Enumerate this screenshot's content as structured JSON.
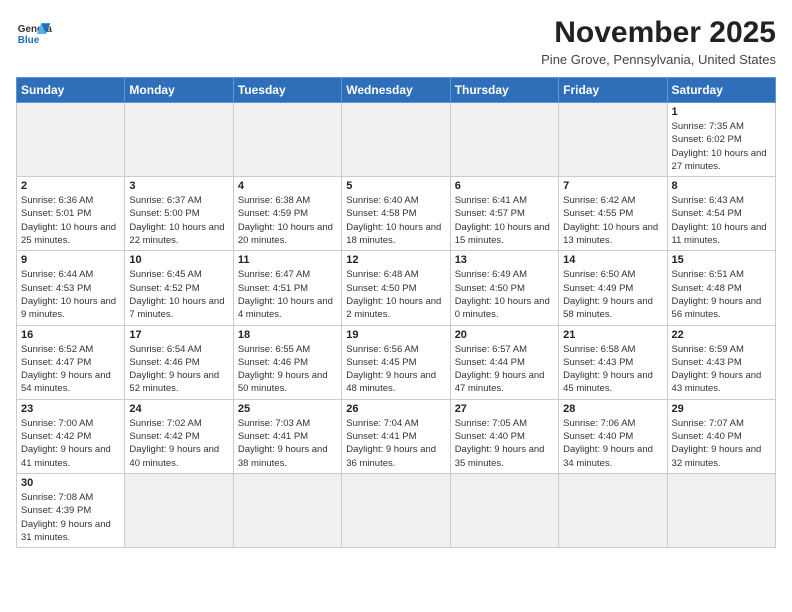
{
  "header": {
    "logo_general": "General",
    "logo_blue": "Blue",
    "title": "November 2025",
    "subtitle": "Pine Grove, Pennsylvania, United States"
  },
  "days_of_week": [
    "Sunday",
    "Monday",
    "Tuesday",
    "Wednesday",
    "Thursday",
    "Friday",
    "Saturday"
  ],
  "weeks": [
    [
      {
        "day": "",
        "empty": true
      },
      {
        "day": "",
        "empty": true
      },
      {
        "day": "",
        "empty": true
      },
      {
        "day": "",
        "empty": true
      },
      {
        "day": "",
        "empty": true
      },
      {
        "day": "",
        "empty": true
      },
      {
        "day": "1",
        "info": "Sunrise: 7:35 AM\nSunset: 6:02 PM\nDaylight: 10 hours and 27 minutes."
      }
    ],
    [
      {
        "day": "2",
        "info": "Sunrise: 6:36 AM\nSunset: 5:01 PM\nDaylight: 10 hours and 25 minutes."
      },
      {
        "day": "3",
        "info": "Sunrise: 6:37 AM\nSunset: 5:00 PM\nDaylight: 10 hours and 22 minutes."
      },
      {
        "day": "4",
        "info": "Sunrise: 6:38 AM\nSunset: 4:59 PM\nDaylight: 10 hours and 20 minutes."
      },
      {
        "day": "5",
        "info": "Sunrise: 6:40 AM\nSunset: 4:58 PM\nDaylight: 10 hours and 18 minutes."
      },
      {
        "day": "6",
        "info": "Sunrise: 6:41 AM\nSunset: 4:57 PM\nDaylight: 10 hours and 15 minutes."
      },
      {
        "day": "7",
        "info": "Sunrise: 6:42 AM\nSunset: 4:55 PM\nDaylight: 10 hours and 13 minutes."
      },
      {
        "day": "8",
        "info": "Sunrise: 6:43 AM\nSunset: 4:54 PM\nDaylight: 10 hours and 11 minutes."
      }
    ],
    [
      {
        "day": "9",
        "info": "Sunrise: 6:44 AM\nSunset: 4:53 PM\nDaylight: 10 hours and 9 minutes."
      },
      {
        "day": "10",
        "info": "Sunrise: 6:45 AM\nSunset: 4:52 PM\nDaylight: 10 hours and 7 minutes."
      },
      {
        "day": "11",
        "info": "Sunrise: 6:47 AM\nSunset: 4:51 PM\nDaylight: 10 hours and 4 minutes."
      },
      {
        "day": "12",
        "info": "Sunrise: 6:48 AM\nSunset: 4:50 PM\nDaylight: 10 hours and 2 minutes."
      },
      {
        "day": "13",
        "info": "Sunrise: 6:49 AM\nSunset: 4:50 PM\nDaylight: 10 hours and 0 minutes."
      },
      {
        "day": "14",
        "info": "Sunrise: 6:50 AM\nSunset: 4:49 PM\nDaylight: 9 hours and 58 minutes."
      },
      {
        "day": "15",
        "info": "Sunrise: 6:51 AM\nSunset: 4:48 PM\nDaylight: 9 hours and 56 minutes."
      }
    ],
    [
      {
        "day": "16",
        "info": "Sunrise: 6:52 AM\nSunset: 4:47 PM\nDaylight: 9 hours and 54 minutes."
      },
      {
        "day": "17",
        "info": "Sunrise: 6:54 AM\nSunset: 4:46 PM\nDaylight: 9 hours and 52 minutes."
      },
      {
        "day": "18",
        "info": "Sunrise: 6:55 AM\nSunset: 4:46 PM\nDaylight: 9 hours and 50 minutes."
      },
      {
        "day": "19",
        "info": "Sunrise: 6:56 AM\nSunset: 4:45 PM\nDaylight: 9 hours and 48 minutes."
      },
      {
        "day": "20",
        "info": "Sunrise: 6:57 AM\nSunset: 4:44 PM\nDaylight: 9 hours and 47 minutes."
      },
      {
        "day": "21",
        "info": "Sunrise: 6:58 AM\nSunset: 4:43 PM\nDaylight: 9 hours and 45 minutes."
      },
      {
        "day": "22",
        "info": "Sunrise: 6:59 AM\nSunset: 4:43 PM\nDaylight: 9 hours and 43 minutes."
      }
    ],
    [
      {
        "day": "23",
        "info": "Sunrise: 7:00 AM\nSunset: 4:42 PM\nDaylight: 9 hours and 41 minutes."
      },
      {
        "day": "24",
        "info": "Sunrise: 7:02 AM\nSunset: 4:42 PM\nDaylight: 9 hours and 40 minutes."
      },
      {
        "day": "25",
        "info": "Sunrise: 7:03 AM\nSunset: 4:41 PM\nDaylight: 9 hours and 38 minutes."
      },
      {
        "day": "26",
        "info": "Sunrise: 7:04 AM\nSunset: 4:41 PM\nDaylight: 9 hours and 36 minutes."
      },
      {
        "day": "27",
        "info": "Sunrise: 7:05 AM\nSunset: 4:40 PM\nDaylight: 9 hours and 35 minutes."
      },
      {
        "day": "28",
        "info": "Sunrise: 7:06 AM\nSunset: 4:40 PM\nDaylight: 9 hours and 34 minutes."
      },
      {
        "day": "29",
        "info": "Sunrise: 7:07 AM\nSunset: 4:40 PM\nDaylight: 9 hours and 32 minutes."
      }
    ],
    [
      {
        "day": "30",
        "info": "Sunrise: 7:08 AM\nSunset: 4:39 PM\nDaylight: 9 hours and 31 minutes."
      },
      {
        "day": "",
        "empty": true
      },
      {
        "day": "",
        "empty": true
      },
      {
        "day": "",
        "empty": true
      },
      {
        "day": "",
        "empty": true
      },
      {
        "day": "",
        "empty": true
      },
      {
        "day": "",
        "empty": true
      }
    ]
  ]
}
